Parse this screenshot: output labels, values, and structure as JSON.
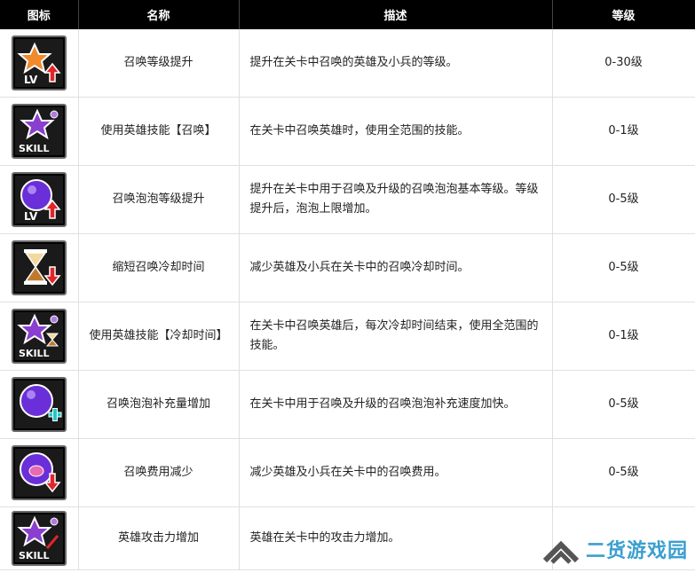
{
  "headers": {
    "icon": "图标",
    "name": "名称",
    "desc": "描述",
    "level": "等级"
  },
  "rows": [
    {
      "icon": "star-lv-up-icon",
      "name": "召唤等级提升",
      "desc": "提升在关卡中召唤的英雄及小兵的等级。",
      "level": "0-30级",
      "badge": "LV"
    },
    {
      "icon": "hero-skill-summon-icon",
      "name": "使用英雄技能【召唤】",
      "desc": "在关卡中召唤英雄时，使用全范围的技能。",
      "level": "0-1级",
      "badge": "SKILL"
    },
    {
      "icon": "bubble-lv-up-icon",
      "name": "召唤泡泡等级提升",
      "desc": "提升在关卡中用于召唤及升级的召唤泡泡基本等级。等级提升后，泡泡上限增加。",
      "level": "0-5级",
      "badge": "LV"
    },
    {
      "icon": "hourglass-down-icon",
      "name": "缩短召唤冷却时间",
      "desc": "减少英雄及小兵在关卡中的召唤冷却时间。",
      "level": "0-5级",
      "badge": ""
    },
    {
      "icon": "hero-skill-cooldown-icon",
      "name": "使用英雄技能【冷却时间】",
      "desc": "在关卡中召唤英雄后，每次冷却时间结束，使用全范围的技能。",
      "level": "0-1级",
      "badge": "SKILL"
    },
    {
      "icon": "bubble-plus-icon",
      "name": "召唤泡泡补充量增加",
      "desc": "在关卡中用于召唤及升级的召唤泡泡补充速度加快。",
      "level": "0-5级",
      "badge": ""
    },
    {
      "icon": "cost-down-icon",
      "name": "召唤费用减少",
      "desc": "减少英雄及小兵在关卡中的召唤费用。",
      "level": "0-5级",
      "badge": ""
    },
    {
      "icon": "hero-skill-attack-icon",
      "name": "英雄攻击力增加",
      "desc": "英雄在关卡中的攻击力增加。",
      "level": "",
      "badge": "SKILL"
    }
  ],
  "watermark": {
    "text": "二货游戏园",
    "icon": "chevron-up-logo-icon"
  },
  "colors": {
    "header_bg": "#000000",
    "border": "#e0e0e0",
    "watermark": "#3a9fcf",
    "arrow_red": "#e0262b"
  }
}
